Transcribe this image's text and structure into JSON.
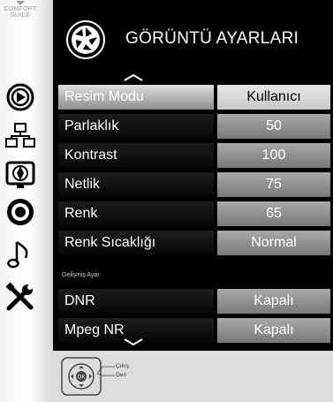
{
  "sidebar": {
    "comfort_guide_line1": "COMFORT",
    "comfort_guide_line2": "GUIDE",
    "icons": [
      "source-icon",
      "network-icon",
      "picture-icon",
      "sound-icon",
      "music-icon",
      "settings-tools-icon"
    ]
  },
  "header": {
    "title": "GÖRÜNTÜ AYARLARI",
    "icon": "camera-aperture-icon"
  },
  "menu": {
    "rows": [
      {
        "label": "Resim Modu",
        "value": "Kullanıcı",
        "selected": true
      },
      {
        "label": "Parlaklık",
        "value": "50"
      },
      {
        "label": "Kontrast",
        "value": "100"
      },
      {
        "label": "Netlik",
        "value": "75"
      },
      {
        "label": "Renk",
        "value": "65"
      },
      {
        "label": "Renk Sıcaklığı",
        "value": "Normal"
      }
    ],
    "section_label": "Gelişmiş Ayar",
    "advanced_rows": [
      {
        "label": "DNR",
        "value": "Kapalı"
      },
      {
        "label": "Mpeg NR",
        "value": "Kapalı"
      }
    ]
  },
  "footer": {
    "hint_exit": "Çıkış",
    "hint_back": "Geri",
    "ok_label": "OK"
  },
  "colors": {
    "accent_row": "#bdbdbd",
    "value_bg": "#8f8f8f",
    "background": "#000000"
  }
}
